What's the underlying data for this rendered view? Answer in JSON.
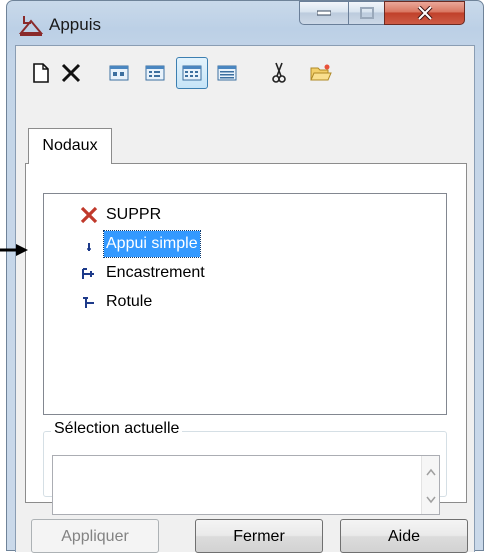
{
  "window": {
    "title": "Appuis"
  },
  "toolbar": {
    "buttons": [
      {
        "icon": "new-document-icon"
      },
      {
        "icon": "delete-x-icon"
      },
      {
        "icon": "view-large-icons-icon"
      },
      {
        "icon": "view-small-icons-icon"
      },
      {
        "icon": "view-list-icon",
        "pressed": true
      },
      {
        "icon": "view-details-icon"
      },
      {
        "icon": "scissors-icon"
      },
      {
        "icon": "open-folder-icon"
      }
    ]
  },
  "tabs": [
    {
      "label": "Nodaux",
      "active": true
    }
  ],
  "support_list": {
    "items": [
      {
        "label": "SUPPR",
        "icon": "delete-x-icon",
        "selected": false
      },
      {
        "label": "Appui simple",
        "icon": "simple-support-icon",
        "selected": true
      },
      {
        "label": "Encastrement",
        "icon": "fixed-support-icon",
        "selected": false
      },
      {
        "label": "Rotule",
        "icon": "hinge-icon",
        "selected": false
      }
    ]
  },
  "current_selection": {
    "label": "Sélection actuelle",
    "value": ""
  },
  "buttons": {
    "apply": "Appliquer",
    "close": "Fermer",
    "help": "Aide"
  },
  "colors": {
    "selection": "#3399ff",
    "delete_red": "#c0392b",
    "icon_blue": "#1d3a8a"
  }
}
